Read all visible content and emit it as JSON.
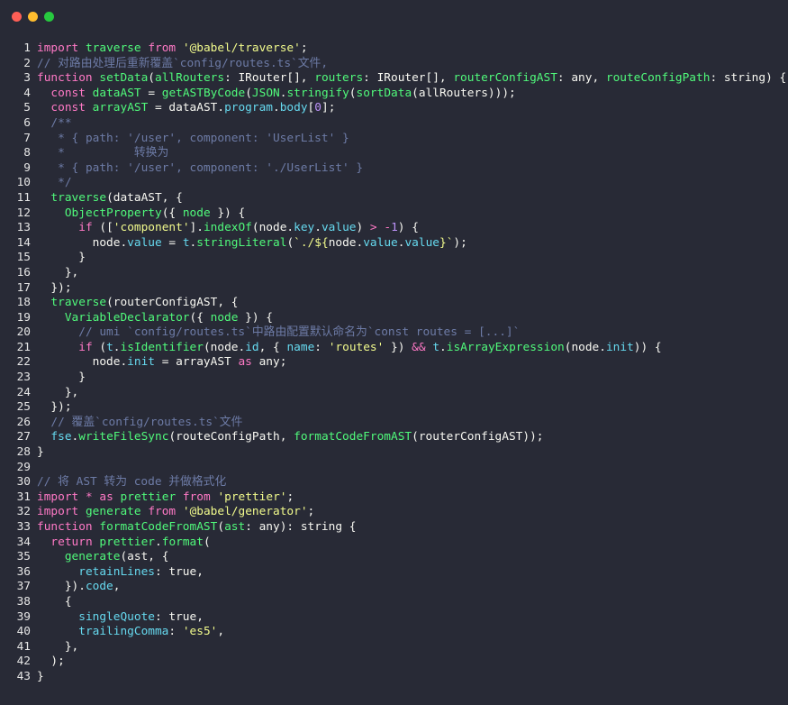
{
  "window": {
    "buttons": [
      {
        "name": "close",
        "color": "#ff5f56"
      },
      {
        "name": "minimize",
        "color": "#ffbd2e"
      },
      {
        "name": "zoom",
        "color": "#27c93f"
      }
    ]
  },
  "code": {
    "lines": [
      [
        [
          "kw",
          "import"
        ],
        [
          "t",
          " "
        ],
        [
          "fn",
          "traverse"
        ],
        [
          "t",
          " "
        ],
        [
          "kw",
          "from"
        ],
        [
          "t",
          " "
        ],
        [
          "str",
          "'@babel/traverse'"
        ],
        [
          "t",
          ";"
        ]
      ],
      [
        [
          "com",
          "// 对路由处理后重新覆盖`config/routes.ts`文件,"
        ]
      ],
      [
        [
          "kw",
          "function"
        ],
        [
          "t",
          " "
        ],
        [
          "fn",
          "setData"
        ],
        [
          "t",
          "("
        ],
        [
          "fn",
          "allRouters"
        ],
        [
          "t",
          ": IRouter[], "
        ],
        [
          "fn",
          "routers"
        ],
        [
          "t",
          ": IRouter[], "
        ],
        [
          "fn",
          "routerConfigAST"
        ],
        [
          "t",
          ": any, "
        ],
        [
          "fn",
          "routeConfigPath"
        ],
        [
          "t",
          ": string) {"
        ]
      ],
      [
        [
          "t",
          "  "
        ],
        [
          "kw",
          "const"
        ],
        [
          "t",
          " "
        ],
        [
          "fn",
          "dataAST"
        ],
        [
          "t",
          " = "
        ],
        [
          "fn",
          "getASTByCode"
        ],
        [
          "t",
          "("
        ],
        [
          "fn",
          "JSON"
        ],
        [
          "t",
          "."
        ],
        [
          "fn",
          "stringify"
        ],
        [
          "t",
          "("
        ],
        [
          "fn",
          "sortData"
        ],
        [
          "t",
          "(allRouters)));"
        ]
      ],
      [
        [
          "t",
          "  "
        ],
        [
          "kw",
          "const"
        ],
        [
          "t",
          " "
        ],
        [
          "fn",
          "arrayAST"
        ],
        [
          "t",
          " = dataAST."
        ],
        [
          "prop",
          "program"
        ],
        [
          "t",
          "."
        ],
        [
          "prop",
          "body"
        ],
        [
          "t",
          "["
        ],
        [
          "num",
          "0"
        ],
        [
          "t",
          "];"
        ]
      ],
      [
        [
          "t",
          "  "
        ],
        [
          "com",
          "/**"
        ]
      ],
      [
        [
          "t",
          "   "
        ],
        [
          "com",
          "* { path: '/user', component: 'UserList' }"
        ]
      ],
      [
        [
          "t",
          "   "
        ],
        [
          "com",
          "*          转换为"
        ]
      ],
      [
        [
          "t",
          "   "
        ],
        [
          "com",
          "* { path: '/user', component: './UserList' }"
        ]
      ],
      [
        [
          "t",
          "   "
        ],
        [
          "com",
          "*/"
        ]
      ],
      [
        [
          "t",
          "  "
        ],
        [
          "fn",
          "traverse"
        ],
        [
          "t",
          "(dataAST, {"
        ]
      ],
      [
        [
          "t",
          "    "
        ],
        [
          "fn",
          "ObjectProperty"
        ],
        [
          "t",
          "({ "
        ],
        [
          "fn",
          "node"
        ],
        [
          "t",
          " }) {"
        ]
      ],
      [
        [
          "t",
          "      "
        ],
        [
          "kw",
          "if"
        ],
        [
          "t",
          " (["
        ],
        [
          "str",
          "'component'"
        ],
        [
          "t",
          "]."
        ],
        [
          "fn",
          "indexOf"
        ],
        [
          "t",
          "(node."
        ],
        [
          "prop",
          "key"
        ],
        [
          "t",
          "."
        ],
        [
          "prop",
          "value"
        ],
        [
          "t",
          ") "
        ],
        [
          "op",
          ">"
        ],
        [
          "t",
          " "
        ],
        [
          "op",
          "-"
        ],
        [
          "num",
          "1"
        ],
        [
          "t",
          ") {"
        ]
      ],
      [
        [
          "t",
          "        node."
        ],
        [
          "prop",
          "value"
        ],
        [
          "t",
          " = "
        ],
        [
          "prop",
          "t"
        ],
        [
          "t",
          "."
        ],
        [
          "fn",
          "stringLiteral"
        ],
        [
          "t",
          "("
        ],
        [
          "str",
          "`./${"
        ],
        [
          "t",
          "node."
        ],
        [
          "prop",
          "value"
        ],
        [
          "t",
          "."
        ],
        [
          "prop",
          "value"
        ],
        [
          "str",
          "}`"
        ],
        [
          "t",
          ");"
        ]
      ],
      [
        [
          "t",
          "      }"
        ]
      ],
      [
        [
          "t",
          "    },"
        ]
      ],
      [
        [
          "t",
          "  });"
        ]
      ],
      [
        [
          "t",
          "  "
        ],
        [
          "fn",
          "traverse"
        ],
        [
          "t",
          "(routerConfigAST, {"
        ]
      ],
      [
        [
          "t",
          "    "
        ],
        [
          "fn",
          "VariableDeclarator"
        ],
        [
          "t",
          "({ "
        ],
        [
          "fn",
          "node"
        ],
        [
          "t",
          " }) {"
        ]
      ],
      [
        [
          "t",
          "      "
        ],
        [
          "com",
          "// umi `config/routes.ts`中路由配置默认命名为`const routes = [...]`"
        ]
      ],
      [
        [
          "t",
          "      "
        ],
        [
          "kw",
          "if"
        ],
        [
          "t",
          " ("
        ],
        [
          "prop",
          "t"
        ],
        [
          "t",
          "."
        ],
        [
          "fn",
          "isIdentifier"
        ],
        [
          "t",
          "(node."
        ],
        [
          "prop",
          "id"
        ],
        [
          "t",
          ", { "
        ],
        [
          "prop",
          "name"
        ],
        [
          "t",
          ": "
        ],
        [
          "str",
          "'routes'"
        ],
        [
          "t",
          " }) "
        ],
        [
          "op",
          "&&"
        ],
        [
          "t",
          " "
        ],
        [
          "prop",
          "t"
        ],
        [
          "t",
          "."
        ],
        [
          "fn",
          "isArrayExpression"
        ],
        [
          "t",
          "(node."
        ],
        [
          "prop",
          "init"
        ],
        [
          "t",
          ")) {"
        ]
      ],
      [
        [
          "t",
          "        node."
        ],
        [
          "prop",
          "init"
        ],
        [
          "t",
          " = arrayAST "
        ],
        [
          "kw",
          "as"
        ],
        [
          "t",
          " any;"
        ]
      ],
      [
        [
          "t",
          "      }"
        ]
      ],
      [
        [
          "t",
          "    },"
        ]
      ],
      [
        [
          "t",
          "  });"
        ]
      ],
      [
        [
          "t",
          "  "
        ],
        [
          "com",
          "// 覆盖`config/routes.ts`文件"
        ]
      ],
      [
        [
          "t",
          "  "
        ],
        [
          "prop",
          "fse"
        ],
        [
          "t",
          "."
        ],
        [
          "fn",
          "writeFileSync"
        ],
        [
          "t",
          "(routeConfigPath, "
        ],
        [
          "fn",
          "formatCodeFromAST"
        ],
        [
          "t",
          "(routerConfigAST));"
        ]
      ],
      [
        [
          "t",
          "}"
        ]
      ],
      [
        [
          "t",
          ""
        ]
      ],
      [
        [
          "com",
          "// 将 AST 转为 code 并做格式化"
        ]
      ],
      [
        [
          "kw",
          "import"
        ],
        [
          "t",
          " "
        ],
        [
          "op",
          "*"
        ],
        [
          "t",
          " "
        ],
        [
          "kw",
          "as"
        ],
        [
          "t",
          " "
        ],
        [
          "fn",
          "prettier"
        ],
        [
          "t",
          " "
        ],
        [
          "kw",
          "from"
        ],
        [
          "t",
          " "
        ],
        [
          "str",
          "'prettier'"
        ],
        [
          "t",
          ";"
        ]
      ],
      [
        [
          "kw",
          "import"
        ],
        [
          "t",
          " "
        ],
        [
          "fn",
          "generate"
        ],
        [
          "t",
          " "
        ],
        [
          "kw",
          "from"
        ],
        [
          "t",
          " "
        ],
        [
          "str",
          "'@babel/generator'"
        ],
        [
          "t",
          ";"
        ]
      ],
      [
        [
          "kw",
          "function"
        ],
        [
          "t",
          " "
        ],
        [
          "fn",
          "formatCodeFromAST"
        ],
        [
          "t",
          "("
        ],
        [
          "fn",
          "ast"
        ],
        [
          "t",
          ": any): string {"
        ]
      ],
      [
        [
          "t",
          "  "
        ],
        [
          "kw",
          "return"
        ],
        [
          "t",
          " "
        ],
        [
          "fn",
          "prettier"
        ],
        [
          "t",
          "."
        ],
        [
          "fn",
          "format"
        ],
        [
          "t",
          "("
        ]
      ],
      [
        [
          "t",
          "    "
        ],
        [
          "fn",
          "generate"
        ],
        [
          "t",
          "(ast, {"
        ]
      ],
      [
        [
          "t",
          "      "
        ],
        [
          "prop",
          "retainLines"
        ],
        [
          "t",
          ": true,"
        ]
      ],
      [
        [
          "t",
          "    })."
        ],
        [
          "prop",
          "code"
        ],
        [
          "t",
          ","
        ]
      ],
      [
        [
          "t",
          "    {"
        ]
      ],
      [
        [
          "t",
          "      "
        ],
        [
          "prop",
          "singleQuote"
        ],
        [
          "t",
          ": true,"
        ]
      ],
      [
        [
          "t",
          "      "
        ],
        [
          "prop",
          "trailingComma"
        ],
        [
          "t",
          ": "
        ],
        [
          "str",
          "'es5'"
        ],
        [
          "t",
          ","
        ]
      ],
      [
        [
          "t",
          "    },"
        ]
      ],
      [
        [
          "t",
          "  );"
        ]
      ],
      [
        [
          "t",
          "}"
        ]
      ]
    ]
  }
}
